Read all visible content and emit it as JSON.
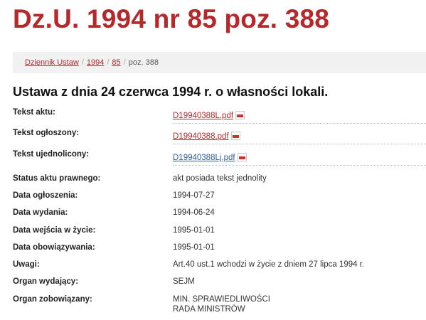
{
  "header": {
    "title": "Dz.U. 1994 nr 85 poz. 388"
  },
  "breadcrumb": {
    "items": [
      "Dziennik Ustaw",
      "1994",
      "85"
    ],
    "current": "poz. 388",
    "separator": "/"
  },
  "document": {
    "title": "Ustawa z dnia 24 czerwca 1994 r. o własności lokali."
  },
  "files": {
    "tekst_aktu": {
      "label": "Tekst aktu:",
      "file": "D19940388L.pdf"
    },
    "tekst_ogloszony": {
      "label": "Tekst ogłoszony:",
      "file": "D19940388.pdf"
    },
    "tekst_ujednolicony": {
      "label": "Tekst ujednolicony:",
      "file": "D19940388Lj.pdf"
    }
  },
  "details": {
    "status": {
      "label": "Status aktu prawnego:",
      "value": "akt posiada tekst jednolity"
    },
    "data_ogloszenia": {
      "label": "Data ogłoszenia:",
      "value": "1994-07-27"
    },
    "data_wydania": {
      "label": "Data wydania:",
      "value": "1994-06-24"
    },
    "data_wejscia": {
      "label": "Data wejścia w życie:",
      "value": "1995-01-01"
    },
    "data_obowiazywania": {
      "label": "Data obowiązywania:",
      "value": "1995-01-01"
    },
    "uwagi": {
      "label": "Uwagi:",
      "value": "Art.40 ust.1 wchodzi w życie z dniem 27 lipca 1994 r."
    },
    "organ_wydajacy": {
      "label": "Organ wydający:",
      "value": "SEJM"
    },
    "organ_zobowiazany": {
      "label": "Organ zobowiązany:",
      "values": [
        "MIN. SPRAWIEDLIWOŚCI",
        "RADA MINISTRÓW"
      ]
    }
  },
  "icons": {
    "pdf": "pdf-file-icon"
  },
  "colors": {
    "accent": "#b5282b",
    "link_alt": "#2a5d9f",
    "breadcrumb_bg": "#f1f1f1"
  }
}
